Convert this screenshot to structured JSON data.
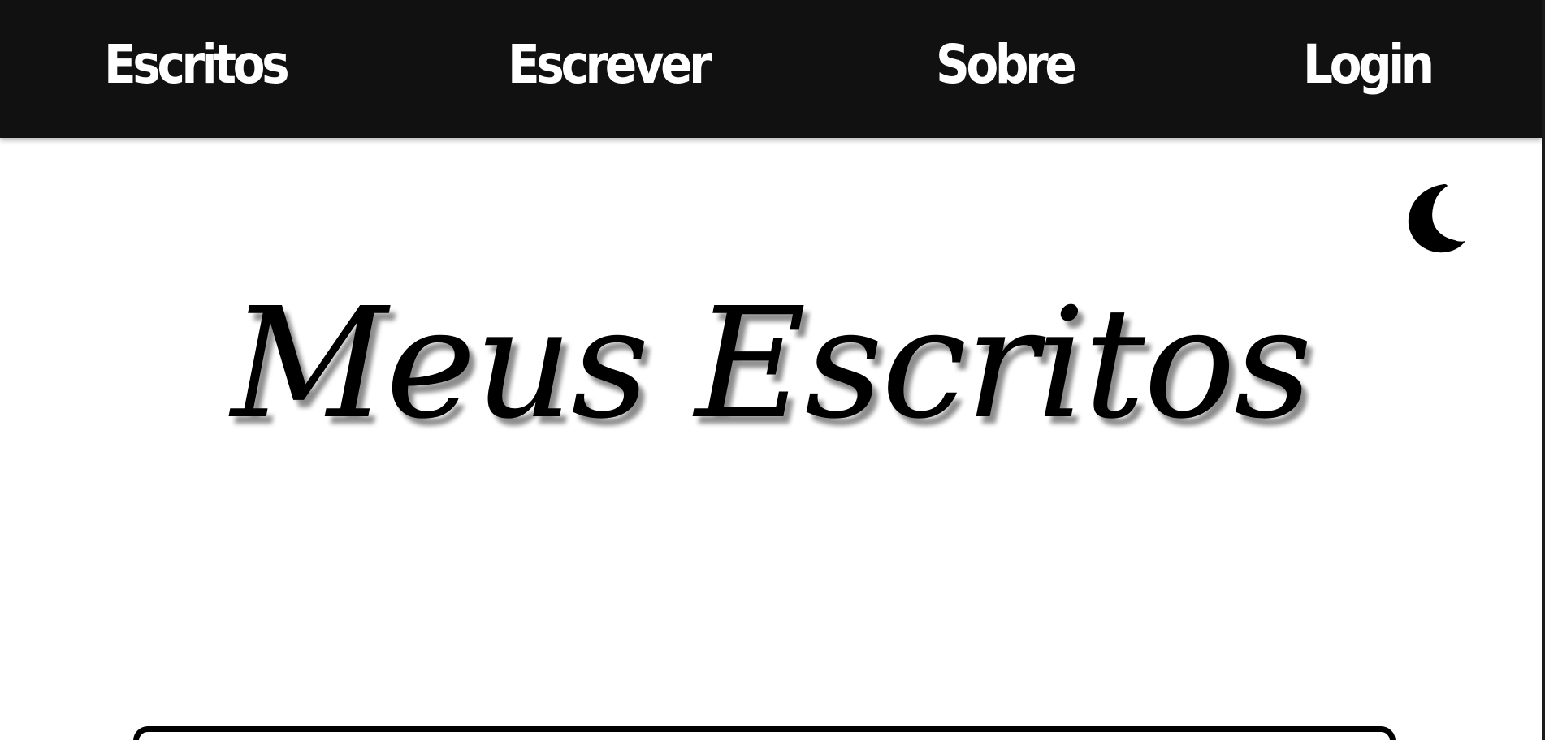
{
  "nav": {
    "items": [
      {
        "label": "Escritos"
      },
      {
        "label": "Escrever"
      },
      {
        "label": "Sobre"
      },
      {
        "label": "Login"
      }
    ]
  },
  "theme_toggle": {
    "icon": "moon-icon"
  },
  "hero": {
    "title": "Meus Escritos"
  },
  "colors": {
    "nav_background": "#111111",
    "nav_text": "#ffffff",
    "page_background": "#ffffff",
    "title": "#000000"
  }
}
